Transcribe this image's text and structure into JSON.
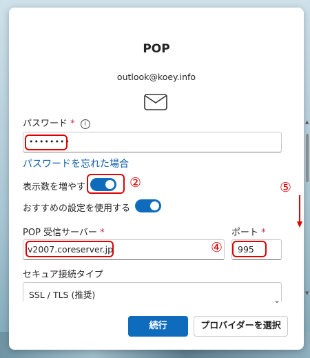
{
  "dialog": {
    "title": "POP",
    "email": "outlook@koey.info"
  },
  "password": {
    "label": "パスワード",
    "required_mark": "*",
    "info": "i",
    "value": "••••••••"
  },
  "forgot_link": "パスワードを忘れた場合",
  "show_more": {
    "label": "表示数を増やす",
    "on": true
  },
  "recommended": {
    "label": "おすすめの設定を使用する",
    "on": true
  },
  "pop_server": {
    "label": "POP 受信サーバー",
    "required_mark": "*",
    "value": "v2007.coreserver.jp"
  },
  "port": {
    "label": "ポート",
    "required_mark": "*",
    "value": "995"
  },
  "security": {
    "label": "セキュア接続タイプ",
    "selected": "SSL / TLS (推奨)"
  },
  "buttons": {
    "continue": "続行",
    "choose_provider": "プロバイダーを選択"
  },
  "annotations": {
    "n2": "②",
    "n4": "④",
    "n5": "⑤"
  },
  "colors": {
    "accent": "#0f6cbd",
    "annotation": "#e00000",
    "link": "#0f5da8"
  }
}
